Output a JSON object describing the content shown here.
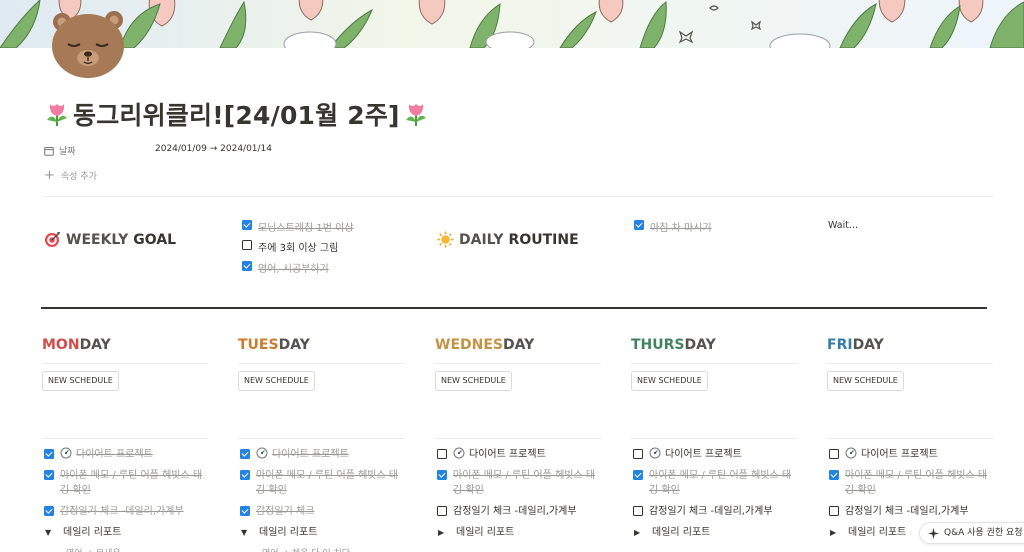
{
  "page": {
    "title": "동그리위클리![24/01월 2주]",
    "title_icon": "tulip-icon"
  },
  "properties": {
    "date_label": "날짜",
    "date_value": "2024/01/09 → 2024/01/14",
    "add_property": "속성 추가"
  },
  "weekly_goal": {
    "heading_main": "WEEKLY",
    "heading_accent": "GOAL",
    "icon": "target-icon",
    "items": [
      {
        "label": "모닝스트레칭 1번 이상",
        "checked": true
      },
      {
        "label": "주에 3회 이상 그림",
        "checked": false
      },
      {
        "label": "영어, 시공부하기",
        "checked": true
      }
    ]
  },
  "daily_routine": {
    "heading_main": "DAILY",
    "heading_accent": "ROUTINE",
    "icon": "sun-icon",
    "items": [
      {
        "label": "아침 차 마시기",
        "checked": true
      }
    ],
    "note": "Wait..."
  },
  "days": [
    {
      "accent": "MON",
      "rest": "DAY",
      "color": "#d44c47",
      "button": "NEW SCHEDULE",
      "tasks": {
        "diet": {
          "label": "다이어트 프로젝트",
          "checked": true
        },
        "memo": {
          "label": "아이폰 메모 / 루틴 어플 헤빗스 태깅 확인",
          "checked": true
        },
        "mood": {
          "label": "감정일기 체크 -데일리,가계부",
          "checked": true
        },
        "report": {
          "label": "데일리 리포트",
          "expanded": true
        }
      },
      "sub": "영어 ✓ 무새우"
    },
    {
      "accent": "TUES",
      "rest": "DAY",
      "color": "#cb7b2b",
      "button": "NEW SCHEDULE",
      "tasks": {
        "diet": {
          "label": "다이어트 프로젝트",
          "checked": true
        },
        "memo": {
          "label": "아이폰 메모 / 루틴 어플 헤빗스 태깅 확인",
          "checked": true
        },
        "mood": {
          "label": "감정일기 체크",
          "checked": true
        },
        "report": {
          "label": "데일리 리포트",
          "expanded": true
        }
      },
      "sub": "영어 ✓ 체육 다 이 치다"
    },
    {
      "accent": "WEDNES",
      "rest": "DAY",
      "color": "#c29343",
      "button": "NEW SCHEDULE",
      "tasks": {
        "diet": {
          "label": "다이어트 프로젝트",
          "checked": false
        },
        "memo": {
          "label": "아이폰 메모 / 루틴 어플 헤빗스 태깅 확인",
          "checked": true
        },
        "mood": {
          "label": "감정일기 체크 -데일리,가계부",
          "checked": false
        },
        "report": {
          "label": "데일리 리포트",
          "expanded": false
        }
      },
      "sub": ""
    },
    {
      "accent": "THURS",
      "rest": "DAY",
      "color": "#448361",
      "button": "NEW SCHEDULE",
      "tasks": {
        "diet": {
          "label": "다이어트 프로젝트",
          "checked": false
        },
        "memo": {
          "label": "아이폰 메모 / 루틴 어플 헤빗스 태깅 확인",
          "checked": true
        },
        "mood": {
          "label": "감정일기 체크 -데일리,가계부",
          "checked": false
        },
        "report": {
          "label": "데일리 리포트",
          "expanded": false
        }
      },
      "sub": ""
    },
    {
      "accent": "FRI",
      "rest": "DAY",
      "color": "#337ea9",
      "button": "NEW SCHEDULE",
      "tasks": {
        "diet": {
          "label": "다이어트 프로젝트",
          "checked": false
        },
        "memo": {
          "label": "아이폰 메모 / 루틴 어플 헤빗스 태깅 확인",
          "checked": true
        },
        "mood": {
          "label": "감정일기 체크 -데일리,가계부",
          "checked": false
        },
        "report": {
          "label": "데일리 리포트",
          "expanded": false
        }
      },
      "sub": ""
    }
  ],
  "qa_button": {
    "label": "Q&A 사용 권한 요청"
  }
}
